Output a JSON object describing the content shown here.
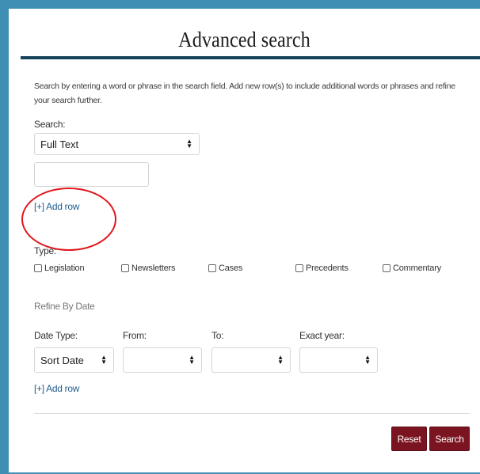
{
  "page": {
    "title": "Advanced search"
  },
  "intro": "Search by entering a word or phrase in the search field. Add new row(s) to include additional words or phrases and refine your search further.",
  "search": {
    "label": "Search:",
    "field_select_value": "Full Text",
    "text_value": "",
    "add_row_label": "[+] Add row"
  },
  "type": {
    "label": "Type:",
    "options": [
      {
        "label": "Legislation",
        "checked": false
      },
      {
        "label": "Newsletters",
        "checked": false
      },
      {
        "label": "Cases",
        "checked": false
      },
      {
        "label": "Precedents",
        "checked": false
      },
      {
        "label": "Commentary",
        "checked": false
      }
    ]
  },
  "refine": {
    "heading": "Refine By Date",
    "date_type_label": "Date Type:",
    "from_label": "From:",
    "to_label": "To:",
    "exact_year_label": "Exact year:",
    "date_type_value": "Sort Date",
    "from_value": "",
    "to_value": "",
    "exact_year_value": "",
    "add_row_label": "[+] Add row"
  },
  "actions": {
    "reset_label": "Reset",
    "search_label": "Search"
  },
  "colors": {
    "background": "#3f8fb5",
    "header_rule": "#17425c",
    "link": "#1f5d8f",
    "button": "#7a1420",
    "annotation": "#e0151b"
  },
  "icons": {
    "select_caret": "up-down-caret-icon"
  }
}
